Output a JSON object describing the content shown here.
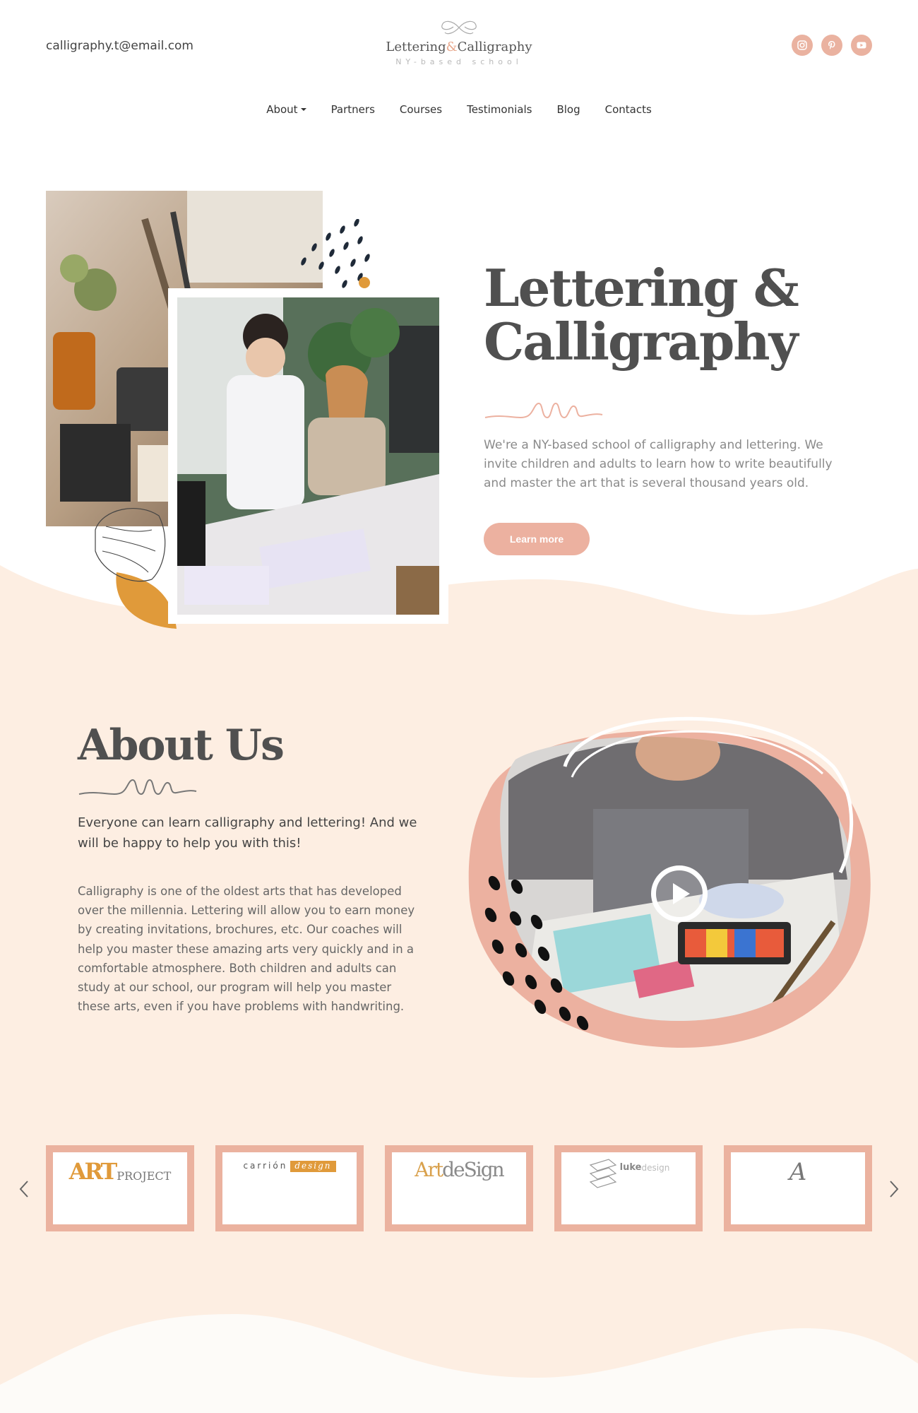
{
  "header": {
    "email": "calligraphy.t@email.com",
    "logo_title_part1": "Lettering",
    "logo_amp": "&",
    "logo_title_part2": "Calligraphy",
    "logo_subtitle": "NY-based school",
    "socials": [
      "instagram-icon",
      "pinterest-icon",
      "youtube-icon"
    ]
  },
  "nav": {
    "items": [
      "About",
      "Partners",
      "Courses",
      "Testimonials",
      "Blog",
      "Contacts"
    ]
  },
  "hero": {
    "title_line1": "Lettering &",
    "title_line2": "Calligraphy",
    "description": "We're a NY-based school of calligraphy and lettering. We invite children and adults to learn how to write beautifully and master the art that is several thousand years old.",
    "button_label": "Learn more"
  },
  "about": {
    "title": "About Us",
    "lead": "Everyone can learn calligraphy and lettering! And we will be happy to help you with this!",
    "body": "Calligraphy is one of the oldest arts that has developed over the millennia. Lettering will allow you to earn money by creating invitations, brochures, etc. Our coaches will help you master these amazing arts very quickly and in a comfortable atmosphere. Both children and adults can study at our school, our program will help you master these arts, even if you have problems with handwriting."
  },
  "partners": {
    "logos": [
      {
        "part1": "ART",
        "part2": "PROJECT"
      },
      {
        "part1": "carrión",
        "part2": "design"
      },
      {
        "part1": "Art",
        "part2": "deSign"
      },
      {
        "part1": "luke",
        "part2": "design"
      },
      {
        "part1": "A",
        "part2": ""
      }
    ]
  },
  "colors": {
    "accent": "#ecb1a0",
    "peach_bg": "#fdeee2",
    "heading": "#505050",
    "gold": "#e09a3a"
  }
}
